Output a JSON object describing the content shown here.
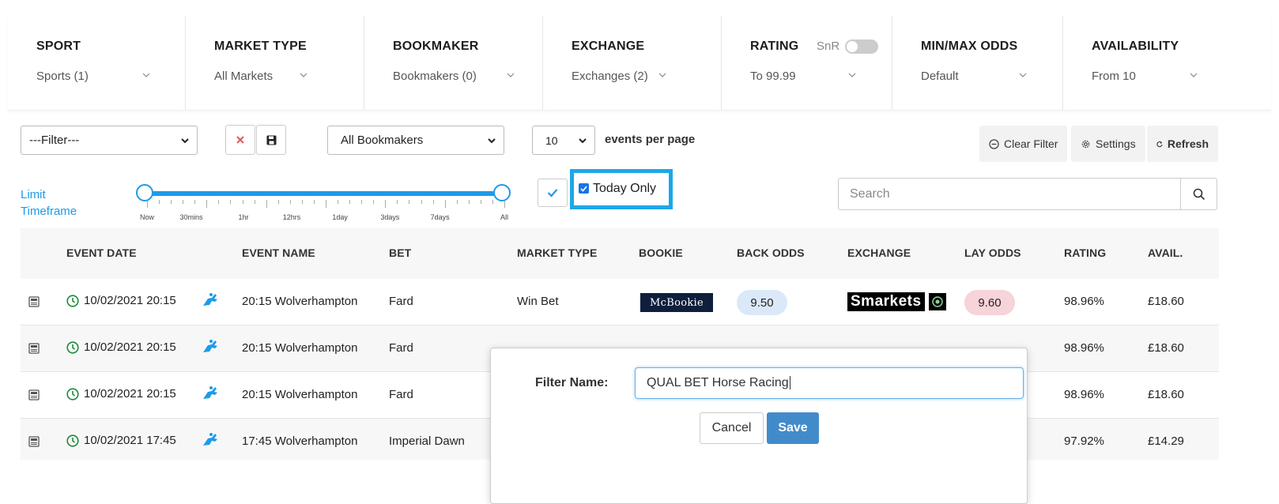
{
  "filters": {
    "sport": {
      "title": "SPORT",
      "value": "Sports (1)"
    },
    "market_type": {
      "title": "MARKET TYPE",
      "value": "All Markets"
    },
    "bookmaker": {
      "title": "BOOKMAKER",
      "value": "Bookmakers (0)"
    },
    "exchange": {
      "title": "EXCHANGE",
      "value": "Exchanges (2)"
    },
    "rating": {
      "title": "RATING",
      "snr_label": "SnR",
      "value": "To 99.99",
      "snr_enabled": false
    },
    "min_max_odds": {
      "title": "MIN/MAX ODDS",
      "value": "Default"
    },
    "availability": {
      "title": "AVAILABILITY",
      "value": "From 10"
    }
  },
  "controls": {
    "filter_select": "---Filter---",
    "bookmakers_select": "All Bookmakers",
    "per_page_select": "10",
    "per_page_label": "events per page",
    "clear_filter": "Clear Filter",
    "settings": "Settings",
    "refresh": "Refresh"
  },
  "timeframe": {
    "label_line1": "Limit",
    "label_line2": "Timeframe",
    "ticks": [
      "Now",
      "30mins",
      "1hr",
      "12hrs",
      "1day",
      "3days",
      "7days",
      "All"
    ],
    "range": [
      "Now",
      "All"
    ]
  },
  "today_only": {
    "label": "Today Only",
    "checked": true
  },
  "search": {
    "placeholder": "Search"
  },
  "table": {
    "headers": [
      "EVENT DATE",
      "EVENT NAME",
      "BET",
      "MARKET TYPE",
      "BOOKIE",
      "BACK ODDS",
      "EXCHANGE",
      "LAY ODDS",
      "RATING",
      "AVAIL."
    ],
    "rows": [
      {
        "date": "10/02/2021 20:15",
        "event": "20:15 Wolverhampton",
        "bet": "Fard",
        "market": "Win Bet",
        "bookie": "McBookie",
        "back": "9.50",
        "exchange": "Smarkets",
        "lay": "9.60",
        "rating": "98.96%",
        "avail": "£18.60"
      },
      {
        "date": "10/02/2021 20:15",
        "event": "20:15 Wolverhampton",
        "bet": "Fard",
        "rating": "98.96%",
        "avail": "£18.60"
      },
      {
        "date": "10/02/2021 20:15",
        "event": "20:15 Wolverhampton",
        "bet": "Fard",
        "rating": "98.96%",
        "avail": "£18.60"
      },
      {
        "date": "10/02/2021 17:45",
        "event": "17:45 Wolverhampton",
        "bet": "Imperial Dawn",
        "rating": "97.92%",
        "avail": "£14.29"
      }
    ]
  },
  "modal": {
    "label": "Filter Name:",
    "value": "QUAL BET Horse Racing",
    "cancel": "Cancel",
    "save": "Save"
  },
  "colors": {
    "accent": "#1e9be8",
    "back_odds": "#dbe8f8",
    "lay_odds": "#f7d3da",
    "save": "#428bca"
  }
}
